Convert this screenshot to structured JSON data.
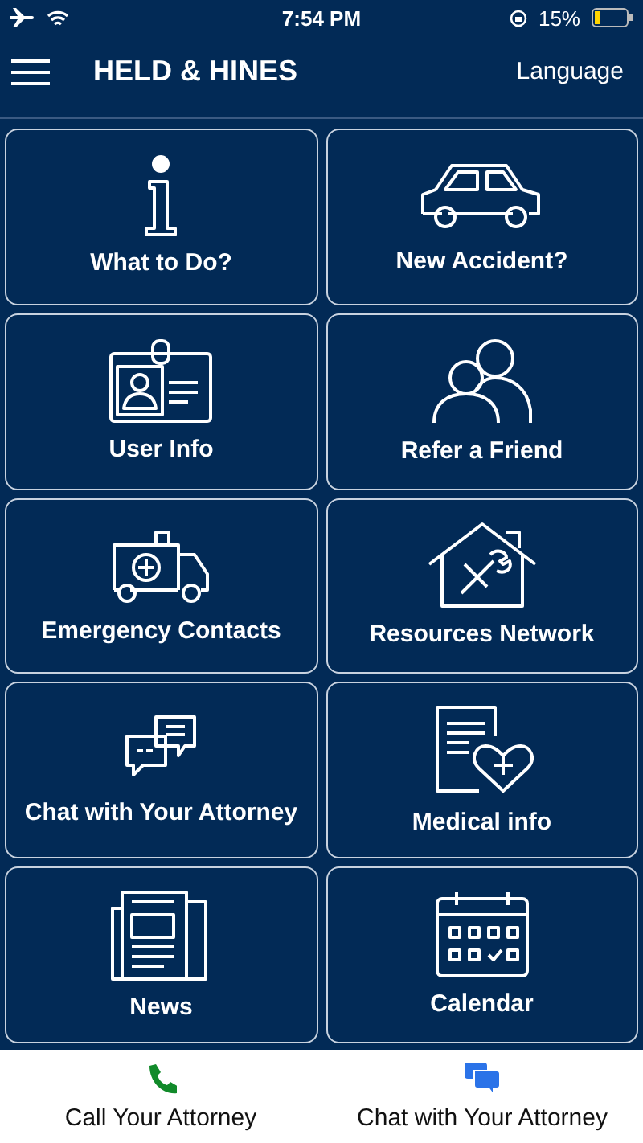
{
  "status_bar": {
    "time": "7:54 PM",
    "battery": "15%"
  },
  "header": {
    "title": "HELD & HINES",
    "language": "Language"
  },
  "tiles": [
    {
      "kind": "info",
      "label": "What to Do?"
    },
    {
      "kind": "car",
      "label": "New Accident?"
    },
    {
      "kind": "badge",
      "label": "User Info"
    },
    {
      "kind": "people",
      "label": "Refer a Friend"
    },
    {
      "kind": "ambulance",
      "label": "Emergency Contacts"
    },
    {
      "kind": "house",
      "label": "Resources Network"
    },
    {
      "kind": "chat",
      "label": "Chat with Your Attorney"
    },
    {
      "kind": "medical",
      "label": "Medical info"
    },
    {
      "kind": "news",
      "label": "News"
    },
    {
      "kind": "calendar",
      "label": "Calendar"
    }
  ],
  "bottom_bar": [
    {
      "kind": "call",
      "label": "Call Your Attorney"
    },
    {
      "kind": "chat",
      "label": "Chat with Your Attorney"
    }
  ]
}
